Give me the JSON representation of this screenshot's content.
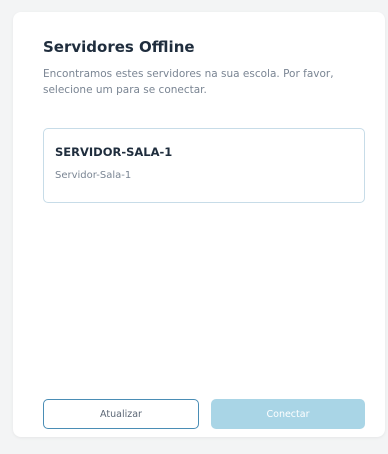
{
  "dialog": {
    "title": "Servidores Offline",
    "description": "Encontramos estes servidores na sua escola. Por favor, selecione um para se conectar."
  },
  "servers": [
    {
      "name": "SERVIDOR-SALA-1",
      "subtitle": "Servidor-Sala-1"
    }
  ],
  "actions": {
    "refresh_label": "Atualizar",
    "connect_label": "Conectar",
    "connect_disabled": true
  },
  "colors": {
    "accent_border": "#4a8db5",
    "connect_disabled_bg": "#a9d5e6",
    "card_border": "#c7dce8",
    "title_text": "#1f2d3d",
    "muted_text": "#7a8593"
  }
}
